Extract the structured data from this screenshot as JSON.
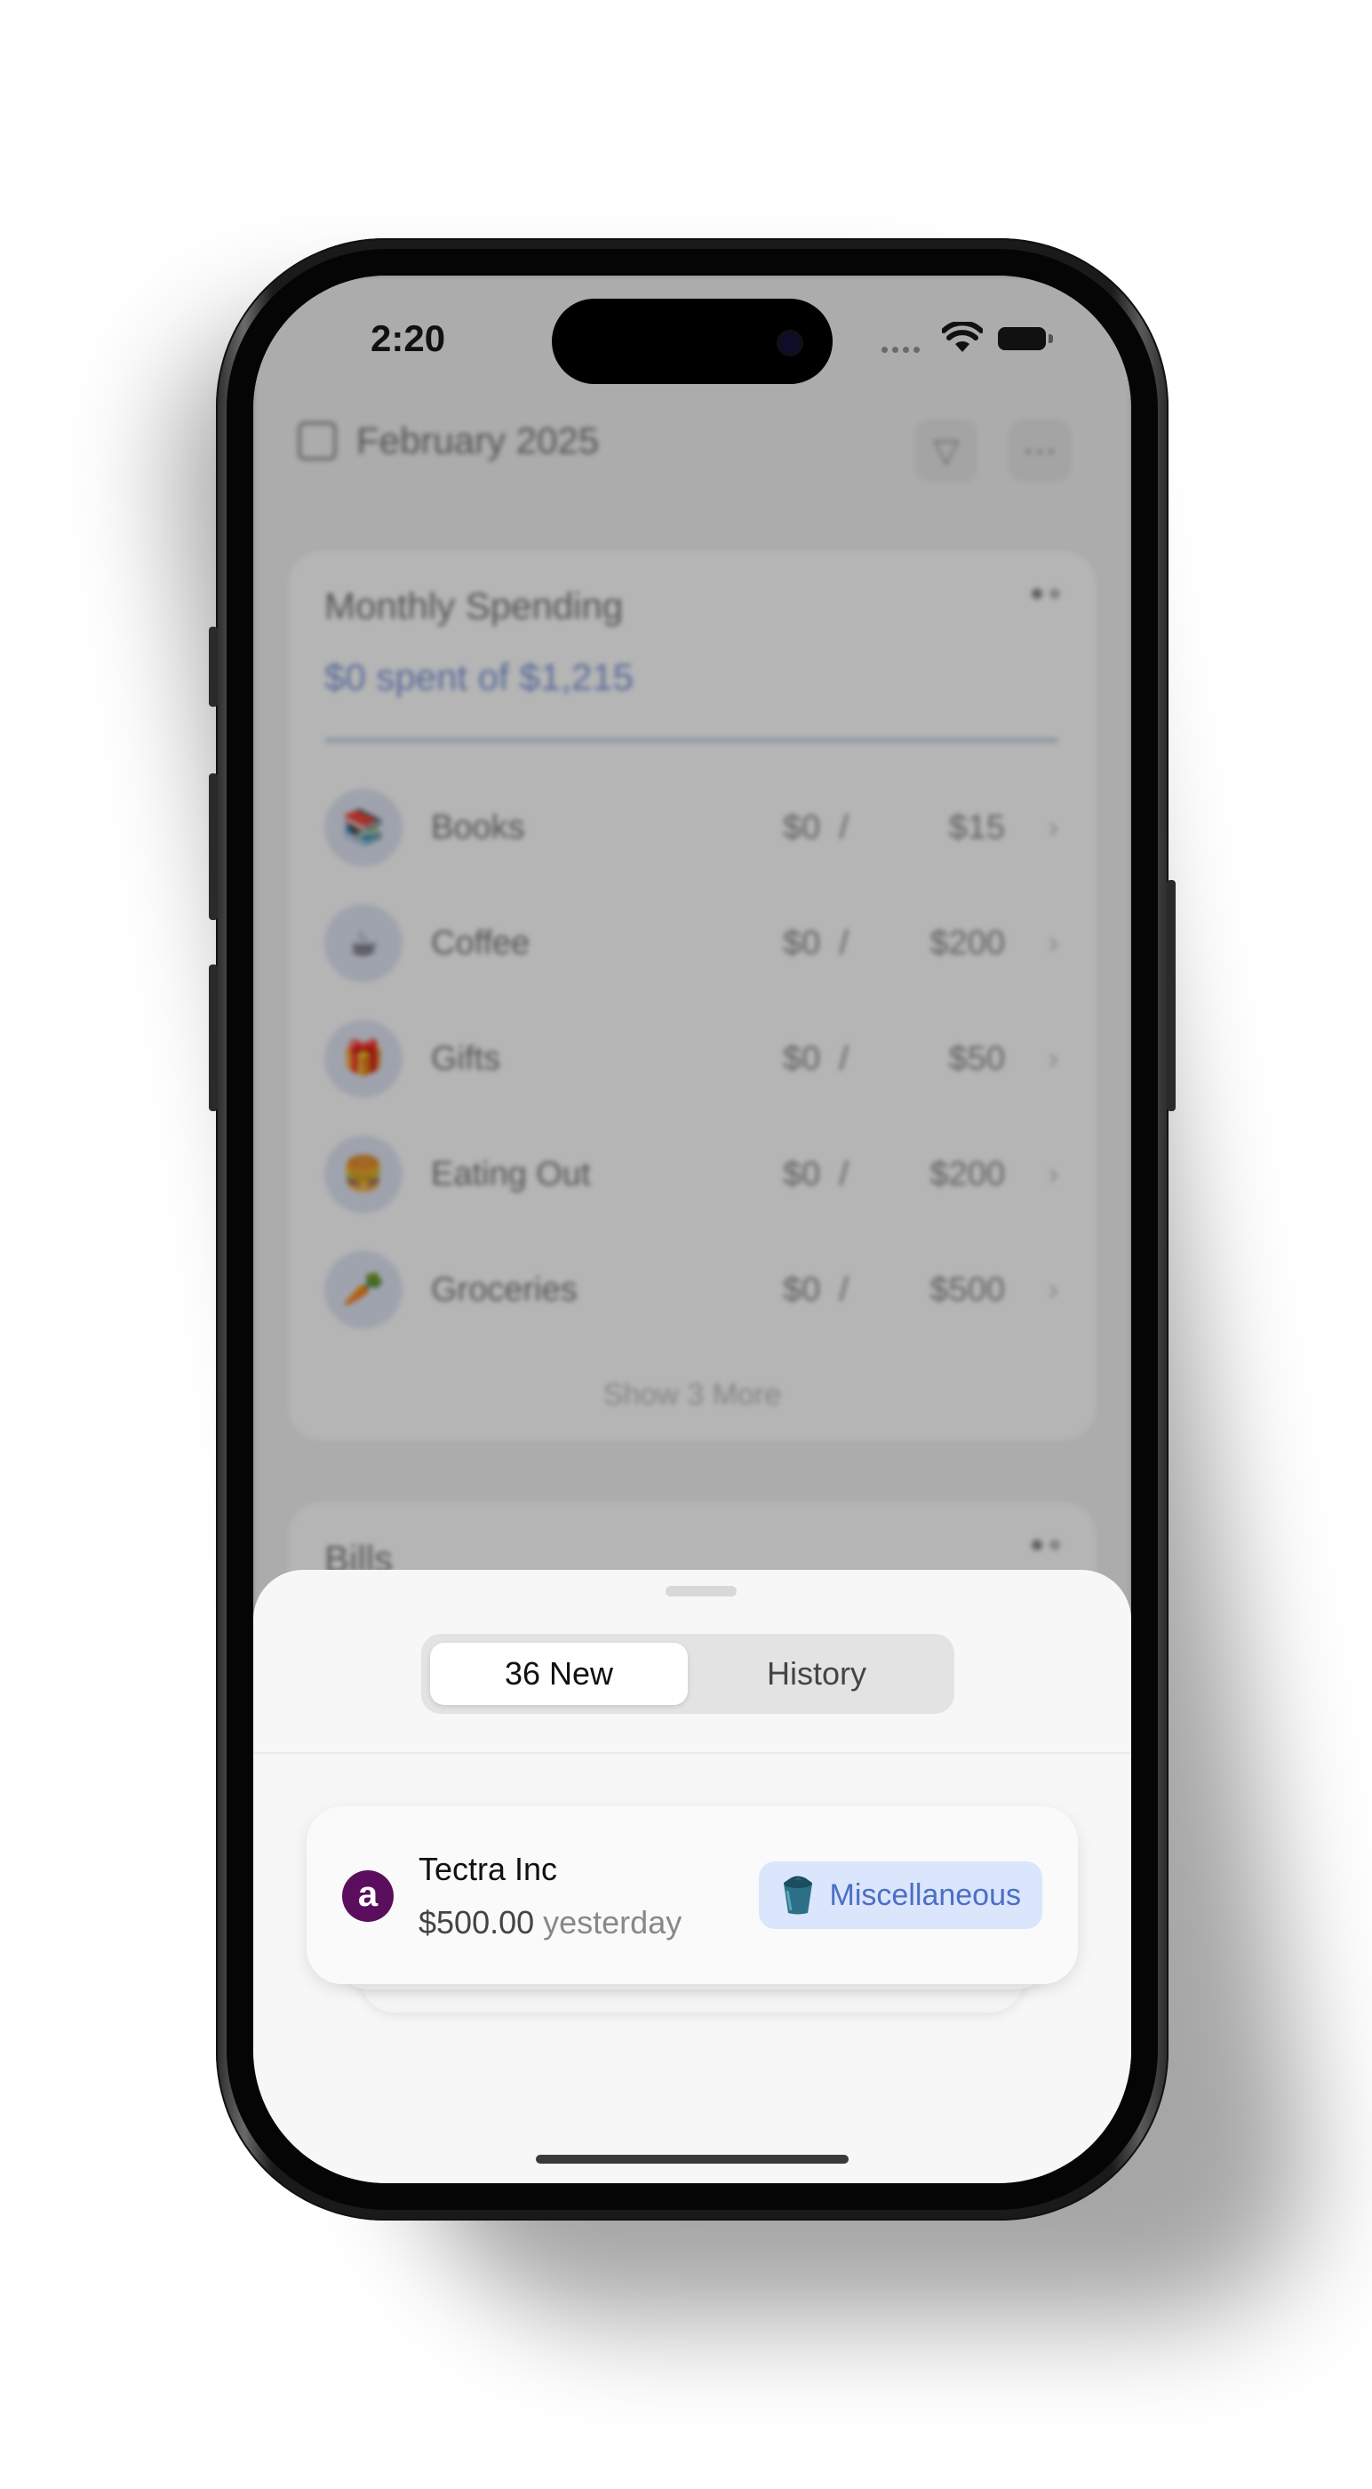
{
  "status_bar": {
    "time": "2:20"
  },
  "background": {
    "header": {
      "month": "February 2025"
    },
    "spending_card": {
      "title": "Monthly Spending",
      "summary": "$0 spent of $1,215",
      "categories": [
        {
          "name": "Books",
          "icon": "books-emoji",
          "spent": "$0",
          "separator": "/",
          "budget": "$15"
        },
        {
          "name": "Coffee",
          "icon": "coffee-emoji",
          "spent": "$0",
          "separator": "/",
          "budget": "$200"
        },
        {
          "name": "Gifts",
          "icon": "gift-emoji",
          "spent": "$0",
          "separator": "/",
          "budget": "$50"
        },
        {
          "name": "Eating Out",
          "icon": "burger-emoji",
          "spent": "$0",
          "separator": "/",
          "budget": "$200"
        },
        {
          "name": "Groceries",
          "icon": "carrot-emoji",
          "spent": "$0",
          "separator": "/",
          "budget": "$500"
        }
      ],
      "show_more": "Show 3 More"
    },
    "bills_card": {
      "title": "Bills"
    }
  },
  "sheet": {
    "tabs": [
      {
        "label": "36 New",
        "selected": true
      },
      {
        "label": "History",
        "selected": false
      }
    ],
    "transaction": {
      "merchant": "Tectra Inc",
      "logo_letter": "a",
      "amount": "$500.00",
      "when": "yesterday",
      "category": "Miscellaneous",
      "category_icon": "bucket-icon"
    }
  },
  "colors": {
    "accent_blue": "#4a6fc7",
    "chip_bg": "#dbe5fb",
    "logo_purple": "#5b0e5e"
  }
}
